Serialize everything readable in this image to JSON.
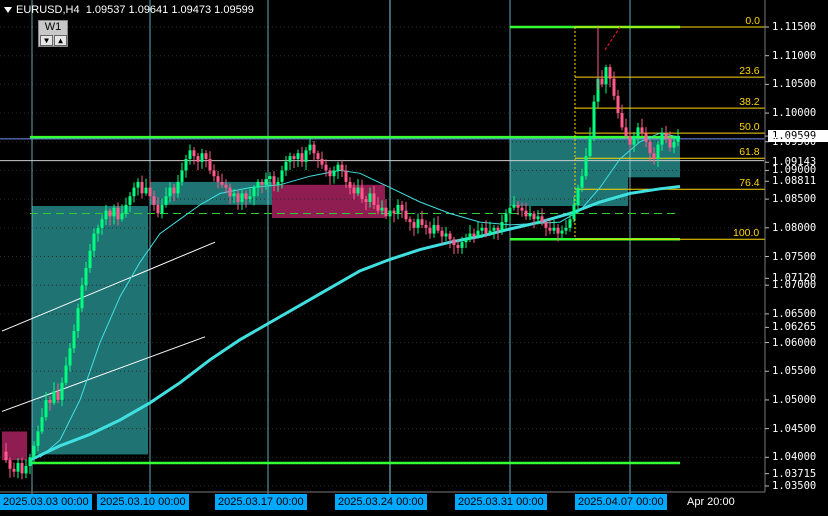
{
  "header": {
    "symbol": "EURUSD,H4",
    "ohlc": "1.09537 1.09641 1.09473 1.09599"
  },
  "timeframe_widget": {
    "label": "W1",
    "down_icon": "▼",
    "up_icon": "▲"
  },
  "price_axis": [
    {
      "value": "1.11500",
      "highlight": false
    },
    {
      "value": "1.11000",
      "highlight": false
    },
    {
      "value": "1.10500",
      "highlight": false
    },
    {
      "value": "1.10000",
      "highlight": false
    },
    {
      "value": "1.09599",
      "highlight": true
    },
    {
      "value": "1.09500",
      "highlight": false
    },
    {
      "value": "1.09143",
      "highlight": false
    },
    {
      "value": "1.09000",
      "highlight": false
    },
    {
      "value": "1.08811",
      "highlight": false
    },
    {
      "value": "1.08500",
      "highlight": false
    },
    {
      "value": "1.08000",
      "highlight": false
    },
    {
      "value": "1.07500",
      "highlight": false
    },
    {
      "value": "1.07120",
      "highlight": false
    },
    {
      "value": "1.07000",
      "highlight": false
    },
    {
      "value": "1.06500",
      "highlight": false
    },
    {
      "value": "1.06265",
      "highlight": false
    },
    {
      "value": "1.06000",
      "highlight": false
    },
    {
      "value": "1.05500",
      "highlight": false
    },
    {
      "value": "1.05000",
      "highlight": false
    },
    {
      "value": "1.04500",
      "highlight": false
    },
    {
      "value": "1.04000",
      "highlight": false
    },
    {
      "value": "1.03715",
      "highlight": false
    },
    {
      "value": "1.03500",
      "highlight": false
    }
  ],
  "fib_levels": [
    "0.0",
    "23.6",
    "38.2",
    "50.0",
    "61.8",
    "76.4",
    "100.0"
  ],
  "time_axis": [
    {
      "label": "2025.03.03 00:00",
      "boxed": true
    },
    {
      "label": "2025.03.10 00:00",
      "boxed": true
    },
    {
      "label": "2025.03.17 00:00",
      "boxed": true
    },
    {
      "label": "2025.03.24 00:00",
      "boxed": true
    },
    {
      "label": "2025.03.31 00:00",
      "boxed": true
    },
    {
      "label": "2025.04.07 00:00",
      "boxed": true
    },
    {
      "label": "Apr 20:00",
      "boxed": false
    }
  ],
  "colors": {
    "background": "#000000",
    "bull_candle": "#00ff7f",
    "bear_candle": "#ff5a8c",
    "fib": "#ffd700",
    "ma": "#40e0e0",
    "zone_teal": "#2a9a9a",
    "zone_maroon": "#a0205a",
    "grid_vertical": "#7fd0e0",
    "axis_box": "#00a8ff",
    "level_green": "#33ff33"
  },
  "chart_data": {
    "type": "candlestick",
    "symbol": "EURUSD",
    "timeframe": "H4",
    "ylim": [
      1.035,
      1.117
    ],
    "fib_retracement": {
      "high": 1.115,
      "low": 1.078,
      "levels": [
        0.0,
        23.6,
        38.2,
        50.0,
        61.8,
        76.4,
        100.0
      ]
    },
    "path": [
      [
        2,
        1.041
      ],
      [
        6,
        1.0395
      ],
      [
        10,
        1.038
      ],
      [
        14,
        1.0375
      ],
      [
        18,
        1.039
      ],
      [
        22,
        1.0372
      ],
      [
        26,
        1.0385
      ],
      [
        30,
        1.04
      ],
      [
        34,
        1.042
      ],
      [
        38,
        1.0445
      ],
      [
        42,
        1.047
      ],
      [
        46,
        1.05
      ],
      [
        50,
        1.0495
      ],
      [
        54,
        1.0515
      ],
      [
        58,
        1.05
      ],
      [
        62,
        1.053
      ],
      [
        66,
        1.056
      ],
      [
        70,
        1.059
      ],
      [
        74,
        1.062
      ],
      [
        78,
        1.066
      ],
      [
        82,
        1.07
      ],
      [
        86,
        1.073
      ],
      [
        90,
        1.076
      ],
      [
        94,
        1.079
      ],
      [
        98,
        1.08
      ],
      [
        102,
        1.0815
      ],
      [
        106,
        1.083
      ],
      [
        110,
        1.082
      ],
      [
        114,
        1.0835
      ],
      [
        118,
        1.0815
      ],
      [
        122,
        1.0825
      ],
      [
        126,
        1.084
      ],
      [
        130,
        1.0855
      ],
      [
        134,
        1.087
      ],
      [
        138,
        1.088
      ],
      [
        142,
        1.086
      ],
      [
        146,
        1.087
      ],
      [
        150,
        1.0855
      ],
      [
        154,
        1.084
      ],
      [
        158,
        1.0825
      ],
      [
        162,
        1.084
      ],
      [
        166,
        1.0855
      ],
      [
        170,
        1.087
      ],
      [
        174,
        1.086
      ],
      [
        178,
        1.088
      ],
      [
        182,
        1.09
      ],
      [
        186,
        1.092
      ],
      [
        190,
        1.0935
      ],
      [
        194,
        1.0925
      ],
      [
        198,
        1.0915
      ],
      [
        202,
        1.093
      ],
      [
        206,
        1.092
      ],
      [
        210,
        1.09
      ],
      [
        214,
        1.089
      ],
      [
        218,
        1.088
      ],
      [
        222,
        1.0875
      ],
      [
        226,
        1.087
      ],
      [
        230,
        1.0855
      ],
      [
        234,
        1.086
      ],
      [
        238,
        1.0845
      ],
      [
        242,
        1.086
      ],
      [
        246,
        1.085
      ],
      [
        250,
        1.0855
      ],
      [
        254,
        1.087
      ],
      [
        258,
        1.088
      ],
      [
        262,
        1.0875
      ],
      [
        266,
        1.0885
      ],
      [
        270,
        1.089
      ],
      [
        274,
        1.0875
      ],
      [
        278,
        1.088
      ],
      [
        282,
        1.09
      ],
      [
        286,
        1.0915
      ],
      [
        290,
        1.0925
      ],
      [
        294,
        1.092
      ],
      [
        298,
        1.093
      ],
      [
        302,
        1.0915
      ],
      [
        306,
        1.0935
      ],
      [
        310,
        1.0945
      ],
      [
        314,
        1.093
      ],
      [
        318,
        1.092
      ],
      [
        322,
        1.091
      ],
      [
        326,
        1.09
      ],
      [
        330,
        1.089
      ],
      [
        334,
        1.09
      ],
      [
        338,
        1.091
      ],
      [
        342,
        1.09
      ],
      [
        346,
        1.088
      ],
      [
        350,
        1.087
      ],
      [
        354,
        1.086
      ],
      [
        358,
        1.087
      ],
      [
        362,
        1.085
      ],
      [
        366,
        1.0845
      ],
      [
        370,
        1.086
      ],
      [
        374,
        1.084
      ],
      [
        378,
        1.083
      ],
      [
        382,
        1.0835
      ],
      [
        386,
        1.082
      ],
      [
        390,
        1.083
      ],
      [
        394,
        1.0825
      ],
      [
        398,
        1.084
      ],
      [
        402,
        1.083
      ],
      [
        406,
        1.0815
      ],
      [
        410,
        1.081
      ],
      [
        414,
        1.08
      ],
      [
        418,
        1.0815
      ],
      [
        422,
        1.0805
      ],
      [
        426,
        1.08
      ],
      [
        430,
        1.079
      ],
      [
        434,
        1.0805
      ],
      [
        438,
        1.0795
      ],
      [
        442,
        1.0785
      ],
      [
        446,
        1.079
      ],
      [
        450,
        1.078
      ],
      [
        454,
        1.077
      ],
      [
        458,
        1.0765
      ],
      [
        462,
        1.0775
      ],
      [
        466,
        1.078
      ],
      [
        470,
        1.079
      ],
      [
        474,
        1.0785
      ],
      [
        478,
        1.0795
      ],
      [
        482,
        1.08
      ],
      [
        486,
        1.079
      ],
      [
        490,
        1.0795
      ],
      [
        494,
        1.08
      ],
      [
        498,
        1.0795
      ],
      [
        502,
        1.081
      ],
      [
        506,
        1.0825
      ],
      [
        510,
        1.0835
      ],
      [
        514,
        1.084
      ],
      [
        518,
        1.0835
      ],
      [
        522,
        1.083
      ],
      [
        526,
        1.082
      ],
      [
        530,
        1.0825
      ],
      [
        534,
        1.0815
      ],
      [
        538,
        1.082
      ],
      [
        542,
        1.081
      ],
      [
        546,
        1.08
      ],
      [
        550,
        1.0795
      ],
      [
        554,
        1.08
      ],
      [
        558,
        1.079
      ],
      [
        562,
        1.0795
      ],
      [
        566,
        1.08
      ],
      [
        570,
        1.0815
      ],
      [
        574,
        1.084
      ],
      [
        578,
        1.087
      ],
      [
        582,
        1.089
      ],
      [
        586,
        1.0925
      ],
      [
        590,
        1.096
      ],
      [
        594,
        1.102
      ],
      [
        598,
        1.106
      ],
      [
        602,
        1.105
      ],
      [
        606,
        1.108
      ],
      [
        610,
        1.106
      ],
      [
        614,
        1.103
      ],
      [
        618,
        1.1
      ],
      [
        622,
        1.0975
      ],
      [
        626,
        1.096
      ],
      [
        630,
        1.0945
      ],
      [
        634,
        1.096
      ],
      [
        638,
        1.0975
      ],
      [
        642,
        1.0965
      ],
      [
        646,
        1.095
      ],
      [
        650,
        1.093
      ],
      [
        654,
        1.092
      ],
      [
        658,
        1.0945
      ],
      [
        662,
        1.0965
      ],
      [
        666,
        1.0955
      ],
      [
        670,
        1.094
      ],
      [
        674,
        1.095
      ],
      [
        678,
        1.096
      ]
    ],
    "moving_average_slow": [
      [
        30,
        1.0395
      ],
      [
        60,
        1.042
      ],
      [
        90,
        1.044
      ],
      [
        120,
        1.0465
      ],
      [
        150,
        1.0495
      ],
      [
        180,
        1.053
      ],
      [
        210,
        1.057
      ],
      [
        240,
        1.0605
      ],
      [
        270,
        1.0635
      ],
      [
        300,
        1.0665
      ],
      [
        330,
        1.0695
      ],
      [
        360,
        1.0725
      ],
      [
        390,
        1.0745
      ],
      [
        420,
        1.0762
      ],
      [
        450,
        1.0775
      ],
      [
        480,
        1.0785
      ],
      [
        510,
        1.0798
      ],
      [
        540,
        1.081
      ],
      [
        570,
        1.0825
      ],
      [
        600,
        1.0845
      ],
      [
        630,
        1.086
      ],
      [
        660,
        1.0868
      ],
      [
        680,
        1.0872
      ]
    ],
    "moving_average_fast": [
      [
        40,
        1.04
      ],
      [
        60,
        1.043
      ],
      [
        80,
        1.05
      ],
      [
        100,
        1.06
      ],
      [
        120,
        1.068
      ],
      [
        140,
        1.074
      ],
      [
        160,
        1.079
      ],
      [
        180,
        1.0815
      ],
      [
        200,
        1.084
      ],
      [
        220,
        1.086
      ],
      [
        250,
        1.087
      ],
      [
        280,
        1.0875
      ],
      [
        310,
        1.089
      ],
      [
        340,
        1.09
      ],
      [
        360,
        1.0895
      ],
      [
        390,
        1.087
      ],
      [
        420,
        1.0845
      ],
      [
        450,
        1.0825
      ],
      [
        480,
        1.081
      ],
      [
        510,
        1.0805
      ],
      [
        540,
        1.0808
      ],
      [
        560,
        1.081
      ],
      [
        580,
        1.083
      ],
      [
        600,
        1.087
      ],
      [
        620,
        1.092
      ],
      [
        640,
        1.095
      ],
      [
        660,
        1.0965
      ],
      [
        680,
        1.0958
      ]
    ]
  }
}
